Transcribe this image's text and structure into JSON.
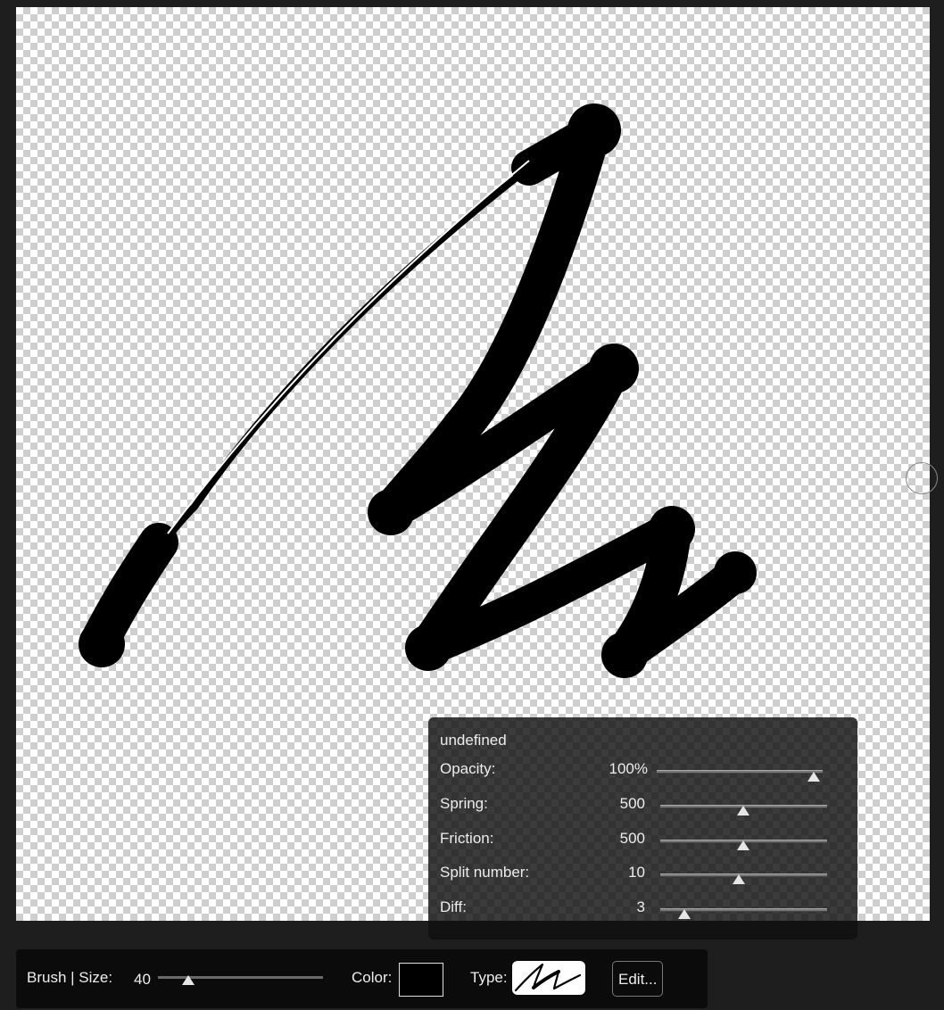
{
  "panel": {
    "title": "undefined",
    "rows": [
      {
        "label": "Opacity:",
        "value": "100%",
        "level": 1.0
      },
      {
        "label": "Spring:",
        "value": "500",
        "level": 0.5
      },
      {
        "label": "Friction:",
        "value": "500",
        "level": 0.5
      },
      {
        "label": "Split number:",
        "value": "10",
        "level": 0.48
      },
      {
        "label": "Diff:",
        "value": "3",
        "level": 0.14
      }
    ]
  },
  "toolbar": {
    "brush_size_label": "Brush | Size:",
    "size_value": "40",
    "size_level": 0.2,
    "color_label": "Color:",
    "color_value": "#000000",
    "type_label": "Type:",
    "edit_label": "Edit..."
  }
}
